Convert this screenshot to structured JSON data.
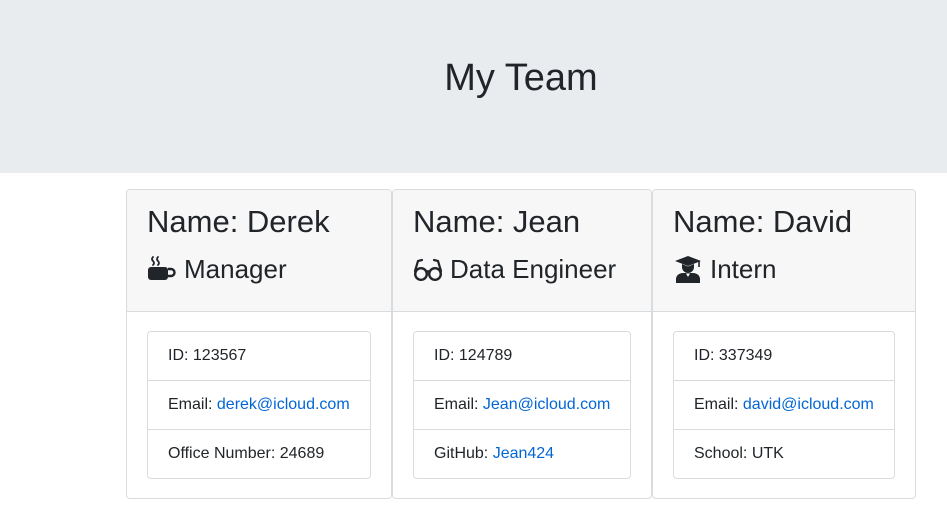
{
  "page": {
    "title": "My Team"
  },
  "team": [
    {
      "name": "Name: Derek",
      "role": "Manager",
      "role_icon": "coffee-icon",
      "id_label": "ID: ",
      "id": "123567",
      "email_label": "Email: ",
      "email": "derek@icloud.com",
      "extra_label": "Office Number: ",
      "extra_value": "24689"
    },
    {
      "name": "Name: Jean",
      "role": "Data Engineer",
      "role_icon": "glasses-icon",
      "id_label": "ID: ",
      "id": "124789",
      "email_label": "Email: ",
      "email": "Jean@icloud.com",
      "extra_label": "GitHub: ",
      "extra_value": "Jean424"
    },
    {
      "name": "Name: David",
      "role": "Intern",
      "role_icon": "graduate-icon",
      "id_label": "ID: ",
      "id": "337349",
      "email_label": "Email: ",
      "email": "david@icloud.com",
      "extra_label": "School: ",
      "extra_value": "UTK"
    }
  ],
  "colors": {
    "header_bg": "#e9ecef",
    "card_header_bg": "#f7f7f7",
    "link": "#0366d6",
    "text": "#212529"
  }
}
